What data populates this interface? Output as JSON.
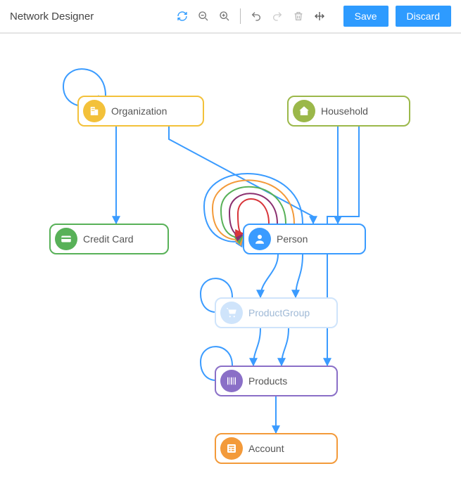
{
  "header": {
    "title": "Network Designer",
    "save_label": "Save",
    "discard_label": "Discard"
  },
  "nodes": {
    "organization": {
      "label": "Organization",
      "color": "#f3c13a",
      "icon": "building-icon"
    },
    "household": {
      "label": "Household",
      "color": "#9bb84a",
      "icon": "home-icon"
    },
    "credit_card": {
      "label": "Credit Card",
      "color": "#58b158",
      "icon": "card-icon"
    },
    "person": {
      "label": "Person",
      "color": "#3a9bff",
      "icon": "person-icon"
    },
    "product_group": {
      "label": "ProductGroup",
      "color": "#cfe4fb",
      "icon": "cart-icon"
    },
    "products": {
      "label": "Products",
      "color": "#8a6fc7",
      "icon": "barcode-icon"
    },
    "account": {
      "label": "Account",
      "color": "#f39a3a",
      "icon": "ledger-icon"
    }
  },
  "edges": [
    {
      "from": "organization",
      "to": "organization",
      "color": "#3a9bff",
      "self_loop": true
    },
    {
      "from": "organization",
      "to": "credit_card",
      "color": "#3a9bff"
    },
    {
      "from": "organization",
      "to": "person",
      "color": "#3a9bff"
    },
    {
      "from": "household",
      "to": "person",
      "color": "#3a9bff"
    },
    {
      "from": "household",
      "to": "products",
      "color": "#3a9bff"
    },
    {
      "from": "person",
      "to": "person",
      "color": "#3a9bff",
      "self_loop": true
    },
    {
      "from": "person",
      "to": "person",
      "color": "#f39a3a",
      "self_loop": true
    },
    {
      "from": "person",
      "to": "person",
      "color": "#58b158",
      "self_loop": true
    },
    {
      "from": "person",
      "to": "person",
      "color": "#8a2f6f",
      "self_loop": true
    },
    {
      "from": "person",
      "to": "person",
      "color": "#d8353a",
      "self_loop": true
    },
    {
      "from": "person",
      "to": "product_group",
      "color": "#3a9bff"
    },
    {
      "from": "person",
      "to": "product_group",
      "color": "#3a9bff"
    },
    {
      "from": "product_group",
      "to": "product_group",
      "color": "#3a9bff",
      "self_loop": true
    },
    {
      "from": "product_group",
      "to": "products",
      "color": "#3a9bff"
    },
    {
      "from": "product_group",
      "to": "products",
      "color": "#3a9bff"
    },
    {
      "from": "products",
      "to": "products",
      "color": "#3a9bff",
      "self_loop": true
    },
    {
      "from": "products",
      "to": "account",
      "color": "#3a9bff"
    }
  ],
  "toolbar_icons": [
    "refresh-icon",
    "zoom-out-icon",
    "zoom-in-icon",
    "undo-icon",
    "redo-icon",
    "delete-icon",
    "fit-icon"
  ]
}
